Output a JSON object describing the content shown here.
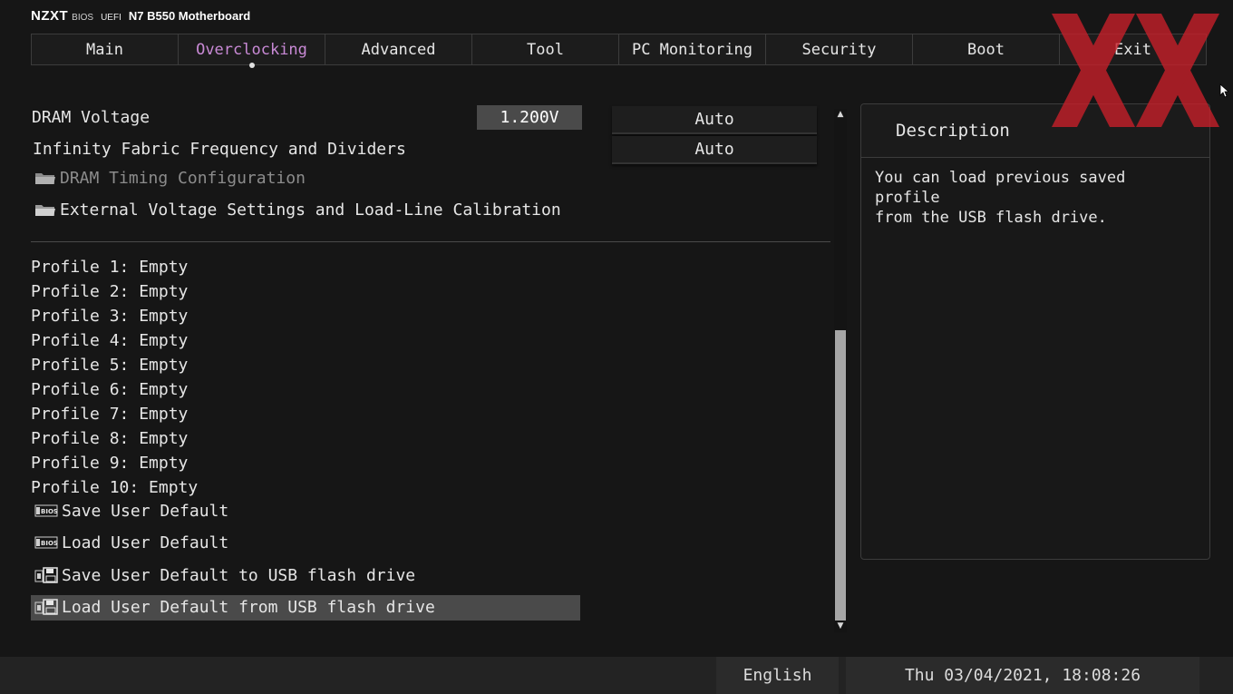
{
  "brand": {
    "logo": "NZXT",
    "bios": "BIOS",
    "uefi": "UEFI",
    "board": "N7 B550 Motherboard"
  },
  "tabs": [
    {
      "label": "Main",
      "active": false
    },
    {
      "label": "Overclocking",
      "active": true
    },
    {
      "label": "Advanced",
      "active": false
    },
    {
      "label": "Tool",
      "active": false
    },
    {
      "label": "PC Monitoring",
      "active": false
    },
    {
      "label": "Security",
      "active": false
    },
    {
      "label": "Boot",
      "active": false
    },
    {
      "label": "Exit",
      "active": false
    }
  ],
  "settings": {
    "dram_voltage": {
      "label": "DRAM Voltage",
      "value": "1.200V",
      "option": "Auto"
    },
    "infinity_fabric": {
      "label": "Infinity Fabric Frequency and Dividers",
      "option": "Auto"
    },
    "dram_timing": {
      "label": "DRAM Timing Configuration"
    },
    "external_voltage": {
      "label": "External Voltage Settings and Load-Line Calibration"
    }
  },
  "profiles": [
    "Profile 1: Empty",
    "Profile 2: Empty",
    "Profile 3: Empty",
    "Profile 4: Empty",
    "Profile 5: Empty",
    "Profile 6: Empty",
    "Profile 7: Empty",
    "Profile 8: Empty",
    "Profile 9: Empty",
    "Profile 10: Empty"
  ],
  "actions": {
    "save_user_default": "Save User Default",
    "load_user_default": "Load User Default",
    "save_usb": "Save User Default to USB flash drive",
    "load_usb": "Load User Default from USB flash drive"
  },
  "description": {
    "title": "Description",
    "text": "You can load previous saved profile\nfrom the USB flash drive."
  },
  "status": {
    "language": "English",
    "datetime": "Thu 03/04/2021, 18:08:26"
  },
  "colors": {
    "active_tab": "#c98ad6",
    "selection": "#4a4a4a",
    "watermark": "#c8202a"
  },
  "icons": [
    "folder-icon",
    "bios-chip-icon",
    "usb-save-icon",
    "scroll-up-arrow-icon",
    "scroll-down-arrow-icon",
    "mouse-cursor-icon",
    "watermark-logo"
  ]
}
